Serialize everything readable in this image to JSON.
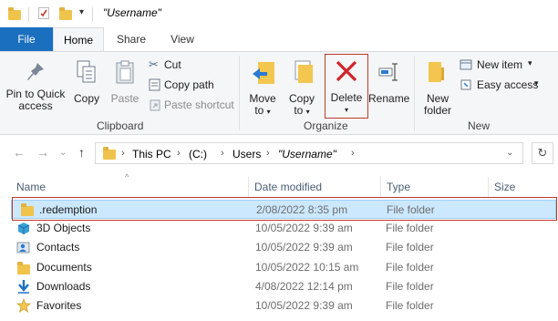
{
  "title": {
    "window_title": "\"Username\""
  },
  "tabs": [
    {
      "label": "File"
    },
    {
      "label": "Home"
    },
    {
      "label": "Share"
    },
    {
      "label": "View"
    }
  ],
  "ribbon": {
    "clipboard": {
      "pin_to_quick_access_line1": "Pin to Quick",
      "pin_to_quick_access_line2": "access",
      "copy": "Copy",
      "paste": "Paste",
      "cut": "Cut",
      "copy_path": "Copy path",
      "paste_shortcut": "Paste shortcut",
      "group_label": "Clipboard"
    },
    "organize": {
      "move_to_line1": "Move",
      "move_to_line2": "to",
      "copy_to_line1": "Copy",
      "copy_to_line2": "to",
      "delete": "Delete",
      "rename": "Rename",
      "group_label": "Organize"
    },
    "new": {
      "new_folder_line1": "New",
      "new_folder_line2": "folder",
      "new_item": "New item",
      "easy_access": "Easy access",
      "group_label": "New"
    }
  },
  "address": {
    "crumbs": [
      "This PC",
      "(C:)",
      "Users",
      "\"Username\""
    ]
  },
  "list": {
    "columns": [
      "Name",
      "Date modified",
      "Type",
      "Size"
    ],
    "rows": [
      {
        "name": ".redemption",
        "date": "2/08/2022 8:35 pm",
        "type": "File folder",
        "icon": "folder-icon"
      },
      {
        "name": "3D Objects",
        "date": "10/05/2022 9:39 am",
        "type": "File folder",
        "icon": "3d-objects-icon"
      },
      {
        "name": "Contacts",
        "date": "10/05/2022 9:39 am",
        "type": "File folder",
        "icon": "contacts-icon"
      },
      {
        "name": "Documents",
        "date": "10/05/2022 10:15 am",
        "type": "File folder",
        "icon": "folder-icon"
      },
      {
        "name": "Downloads",
        "date": "4/08/2022 12:14 pm",
        "type": "File folder",
        "icon": "downloads-icon"
      },
      {
        "name": "Favorites",
        "date": "10/05/2022 9:39 am",
        "type": "File folder",
        "icon": "favorites-icon"
      }
    ]
  },
  "colors": {
    "accent": "#1a6fbf",
    "selection": "#cce8ff",
    "highlight": "#c0392b"
  }
}
